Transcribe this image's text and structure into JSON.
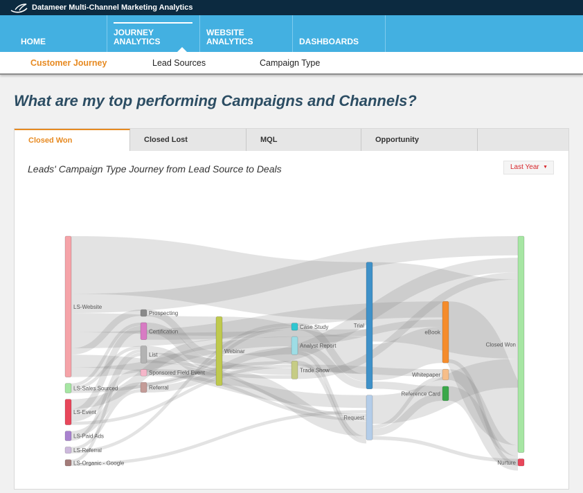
{
  "app": {
    "title": "Datameer Multi-Channel Marketing Analytics"
  },
  "nav": {
    "items": [
      {
        "label": "HOME"
      },
      {
        "label": "JOURNEY\nANALYTICS"
      },
      {
        "label": "WEBSITE\nANALYTICS"
      },
      {
        "label": "DASHBOARDS"
      }
    ],
    "active_index": 1
  },
  "subnav": {
    "items": [
      {
        "label": "Customer Journey"
      },
      {
        "label": "Lead Sources"
      },
      {
        "label": "Campaign Type"
      }
    ],
    "active_index": 0
  },
  "page": {
    "title": "What are my top performing Campaigns and Channels?"
  },
  "tabs": {
    "items": [
      {
        "label": "Closed Won"
      },
      {
        "label": "Closed Lost"
      },
      {
        "label": "MQL"
      },
      {
        "label": "Opportunity"
      }
    ],
    "active_index": 0
  },
  "chart_header": {
    "title": "Leads' Campaign Type Journey from Lead Source to Deals",
    "filter": "Last Year"
  },
  "chart_data": {
    "type": "sankey",
    "stages": [
      [
        {
          "name": "LS-Website",
          "color": "#f5a3a8",
          "value": 44
        },
        {
          "name": "LS-Sales Sourced",
          "color": "#a6e6a3",
          "value": 3
        },
        {
          "name": "LS-Event",
          "color": "#e8475b",
          "value": 8
        },
        {
          "name": "LS-Paid Ads",
          "color": "#a982cf",
          "value": 3
        },
        {
          "name": "LS-Referral",
          "color": "#cdb9dc",
          "value": 2
        },
        {
          "name": "LS-Organic - Google",
          "color": "#a37c7a",
          "value": 2
        }
      ],
      [
        {
          "name": "Prospecting",
          "color": "#8a8a8a",
          "value": 2
        },
        {
          "name": "Certification",
          "color": "#d77bc3",
          "value": 5
        },
        {
          "name": "List",
          "color": "#b3b3b3",
          "value": 5
        },
        {
          "name": "Sponsored Field Event",
          "color": "#f5b6c9",
          "value": 2
        },
        {
          "name": "Referral",
          "color": "#c49c98",
          "value": 3
        }
      ],
      [
        {
          "name": "Webinar",
          "color": "#bfc94d",
          "value": 18
        }
      ],
      [
        {
          "name": "Case Study",
          "color": "#2fc7d1",
          "value": 2
        },
        {
          "name": "Analyst Report",
          "color": "#9edde5",
          "value": 5
        },
        {
          "name": "Trade Show",
          "color": "#c6cc85",
          "value": 5
        }
      ],
      [
        {
          "name": "Trial",
          "color": "#3f91c8",
          "value": 34
        },
        {
          "name": "Request",
          "color": "#b4cde9",
          "value": 12
        }
      ],
      [
        {
          "name": "eBook",
          "color": "#f58c2c",
          "value": 17
        },
        {
          "name": "Whitepaper",
          "color": "#f6be8a",
          "value": 3
        },
        {
          "name": "Reference Card",
          "color": "#3ba84a",
          "value": 4
        }
      ],
      [
        {
          "name": "Closed Won",
          "color": "#a6e6a3",
          "value": 60
        },
        {
          "name": "Nurture",
          "color": "#e8475b",
          "value": 2
        }
      ]
    ],
    "links": [
      [
        "LS-Website",
        "Trial",
        18
      ],
      [
        "LS-Website",
        "Closed Won",
        6
      ],
      [
        "LS-Website",
        "Webinar",
        6
      ],
      [
        "LS-Website",
        "eBook",
        5
      ],
      [
        "LS-Website",
        "Prospecting",
        2
      ],
      [
        "LS-Website",
        "Request",
        4
      ],
      [
        "LS-Website",
        "Analyst Report",
        3
      ],
      [
        "LS-Sales Sourced",
        "Certification",
        1
      ],
      [
        "LS-Sales Sourced",
        "List",
        1
      ],
      [
        "LS-Sales Sourced",
        "Trade Show",
        1
      ],
      [
        "LS-Event",
        "Webinar",
        3
      ],
      [
        "LS-Event",
        "Certification",
        2
      ],
      [
        "LS-Event",
        "Sponsored Field Event",
        2
      ],
      [
        "LS-Event",
        "Trade Show",
        1
      ],
      [
        "LS-Paid Ads",
        "Referral",
        2
      ],
      [
        "LS-Paid Ads",
        "List",
        1
      ],
      [
        "LS-Referral",
        "Referral",
        1
      ],
      [
        "LS-Referral",
        "Case Study",
        1
      ],
      [
        "LS-Organic - Google",
        "List",
        1
      ],
      [
        "LS-Organic - Google",
        "Request",
        1
      ],
      [
        "Prospecting",
        "Webinar",
        2
      ],
      [
        "Certification",
        "Webinar",
        3
      ],
      [
        "Certification",
        "Trial",
        2
      ],
      [
        "List",
        "Webinar",
        2
      ],
      [
        "List",
        "Trade Show",
        2
      ],
      [
        "List",
        "Request",
        1
      ],
      [
        "Sponsored Field Event",
        "Trade Show",
        1
      ],
      [
        "Sponsored Field Event",
        "Request",
        1
      ],
      [
        "Referral",
        "Case Study",
        1
      ],
      [
        "Referral",
        "Analyst Report",
        2
      ],
      [
        "Webinar",
        "Trial",
        10
      ],
      [
        "Webinar",
        "Closed Won",
        4
      ],
      [
        "Webinar",
        "Request",
        4
      ],
      [
        "Case Study",
        "Trial",
        2
      ],
      [
        "Analyst Report",
        "eBook",
        2
      ],
      [
        "Analyst Report",
        "Trial",
        2
      ],
      [
        "Analyst Report",
        "Request",
        1
      ],
      [
        "Trade Show",
        "Request",
        1
      ],
      [
        "Trade Show",
        "Whitepaper",
        2
      ],
      [
        "Trade Show",
        "Closed Won",
        2
      ],
      [
        "Trial",
        "Closed Won",
        22
      ],
      [
        "Trial",
        "eBook",
        10
      ],
      [
        "Trial",
        "Reference Card",
        2
      ],
      [
        "Request",
        "Closed Won",
        8
      ],
      [
        "Request",
        "Whitepaper",
        1
      ],
      [
        "Request",
        "Reference Card",
        2
      ],
      [
        "Request",
        "Nurture",
        1
      ],
      [
        "eBook",
        "Closed Won",
        16
      ],
      [
        "eBook",
        "Nurture",
        1
      ],
      [
        "Whitepaper",
        "Closed Won",
        3
      ],
      [
        "Reference Card",
        "Closed Won",
        4
      ]
    ]
  }
}
